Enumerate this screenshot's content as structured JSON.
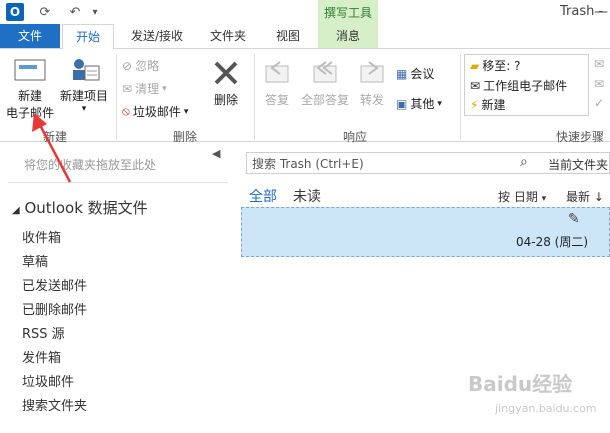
{
  "titlebar": {
    "window_title": "Trash -",
    "context_group": "撰写工具"
  },
  "tabs": {
    "file": "文件",
    "home": "开始",
    "send_receive": "发送/接收",
    "folder": "文件夹",
    "view": "视图",
    "message": "消息"
  },
  "ribbon": {
    "new_email_line1": "新建",
    "new_email_line2": "电子邮件",
    "new_items": "新建项目",
    "group_new": "新建",
    "ignore": "忽略",
    "clean_up": "清理",
    "junk": "垃圾邮件",
    "delete": "删除",
    "group_delete": "删除",
    "reply": "答复",
    "reply_all": "全部答复",
    "forward": "转发",
    "meeting": "会议",
    "more": "其他",
    "group_respond": "响应",
    "qs_move_to": "移至: ?",
    "qs_team_email": "工作组电子邮件",
    "qs_new": "新建",
    "group_quick_steps": "快速步骤"
  },
  "nav": {
    "favorites_hint": "将您的收藏夹拖放至此处",
    "account": "Outlook 数据文件",
    "folders": [
      "收件箱",
      "草稿",
      "已发送邮件",
      "已删除邮件",
      "RSS 源",
      "发件箱",
      "垃圾邮件",
      "搜索文件夹"
    ]
  },
  "list": {
    "search_placeholder": "搜索 Trash (Ctrl+E)",
    "scope": "当前文件夹",
    "filter_all": "全部",
    "filter_unread": "未读",
    "sort_by": "按 日期",
    "sort_order": "最新",
    "message_date": "04-28 (周二)"
  },
  "watermark": {
    "main": "Baidu经验",
    "sub": "jingyan.baidu.com"
  },
  "colors": {
    "file_tab": "#1f6fc5",
    "context_green": "#d6efc9",
    "selected_row": "#cde6f7",
    "arrow": "#e53935"
  }
}
